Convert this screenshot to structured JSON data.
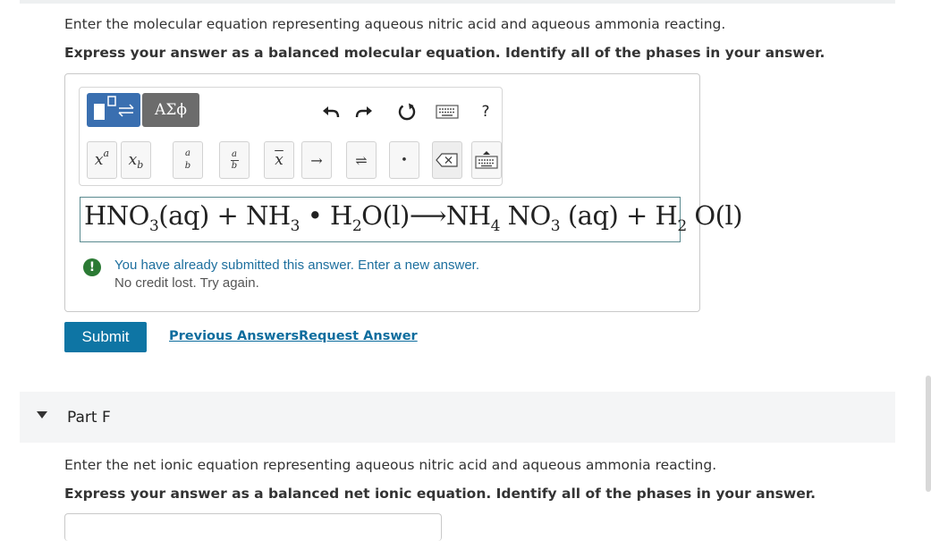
{
  "question": {
    "prompt": "Enter the molecular equation representing aqueous nitric acid and aqueous ammonia reacting.",
    "instruction": "Express your answer as a balanced molecular equation. Identify all of the phases in your answer."
  },
  "toolbar": {
    "symbols_label": "ΑΣϕ",
    "help_label": "?",
    "keys": {
      "superscript_base": "x",
      "superscript_exp": "a",
      "subscript_base": "x",
      "subscript_sub": "b",
      "frac_num": "a",
      "frac_den": "b",
      "mixed_num": "a",
      "mixed_den": "b",
      "bar_x": "x",
      "arrow": "→",
      "equilibrium": "⇌",
      "dot": "•"
    }
  },
  "answer": {
    "t1": "HNO",
    "s1": "3",
    "t2": "(aq) + NH",
    "s2": "3",
    "t3": " • H",
    "s3": "2",
    "t4": "O(l)⟶NH",
    "s4": "4",
    "t5": " NO",
    "s5": "3",
    "t6": " (aq) + H",
    "s6": "2",
    "t7": " O(l)"
  },
  "alert": {
    "line1": "You have already submitted this answer. Enter a new answer.",
    "line2": "No credit lost. Try again."
  },
  "actions": {
    "submit": "Submit",
    "previous_answers": "Previous Answers",
    "request_answer": "Request Answer"
  },
  "part_f": {
    "title": "Part F",
    "prompt": "Enter the net ionic equation representing aqueous nitric acid and aqueous ammonia reacting.",
    "instruction": "Express your answer as a balanced net ionic equation. Identify all of the phases in your answer."
  },
  "colors": {
    "submit_bg": "#0e75a4",
    "link": "#0e6d9e",
    "template_button": "#3a6fb0",
    "symbol_button": "#6c6c6c",
    "alert_icon": "#2b7a34",
    "alert_text": "#1d6f9e"
  }
}
